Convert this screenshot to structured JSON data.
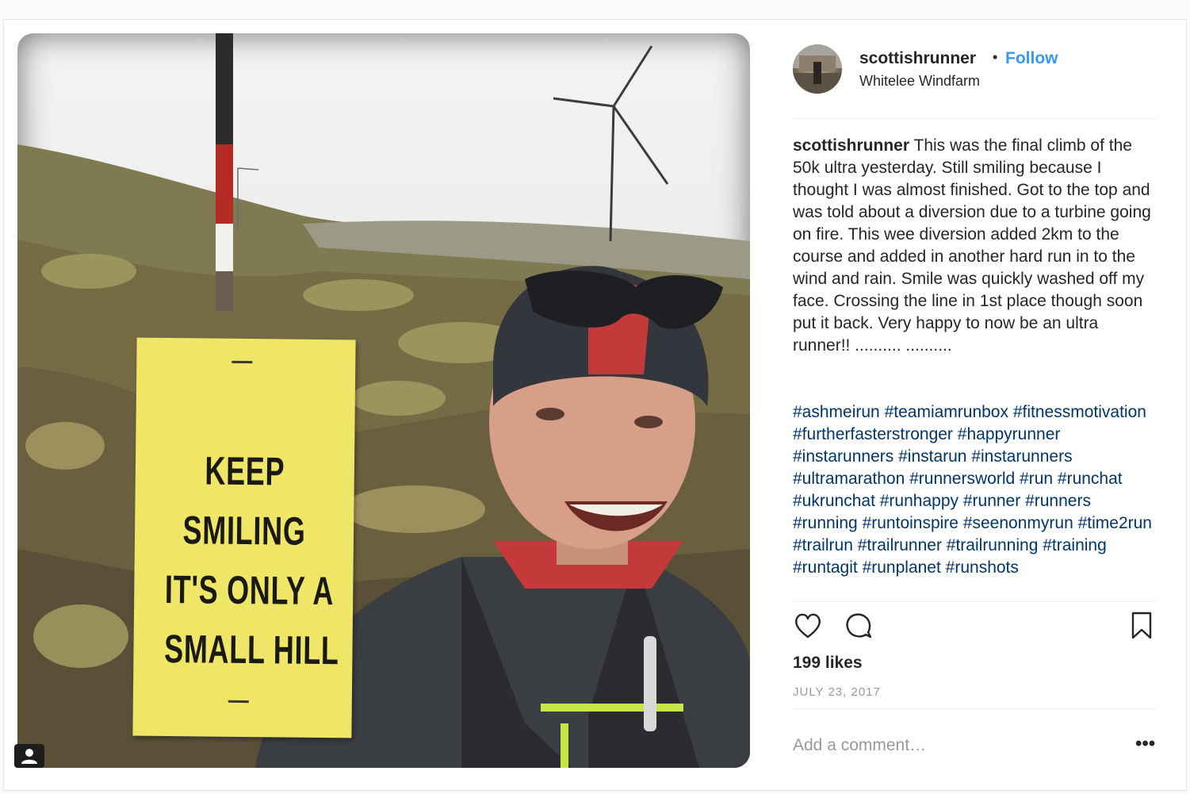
{
  "post": {
    "username": "scottishrunner",
    "separator": "•",
    "follow_label": "Follow",
    "location": "Whitelee Windfarm",
    "caption_user": "scottishrunner",
    "caption_text": "This was the final climb of the 50k ultra yesterday. Still smiling because I thought I was almost finished. Got to the top and was told about a diversion due to a turbine going on fire. This wee diversion added 2km to the course and added in another hard run in to the wind and rain. Smile was quickly washed off my face. Crossing the line in 1st place though soon put it back. Very happy to now be an ultra runner!! .......... ..........",
    "hashtags": [
      "#ashmeirun",
      "#teamiamrunbox",
      "#fitnessmotivation",
      "#furtherfasterstronger",
      "#happyrunner",
      "#instarunners",
      "#instarun",
      "#instarunners",
      "#ultramarathon",
      "#runnersworld",
      "#run",
      "#runchat",
      "#ukrunchat",
      "#runhappy",
      "#runner",
      "#runners",
      "#running",
      "#runtoinspire",
      "#seenonmyrun",
      "#time2run",
      "#trailrun",
      "#trailrunner",
      "#trailrunning",
      "#training",
      "#runtagit",
      "#runplanet",
      "#runshots"
    ],
    "likes": "199 likes",
    "date": "JULY 23, 2017",
    "comment_placeholder": "Add a comment…",
    "more_label": "•••"
  },
  "photo": {
    "sign_lines": [
      "KEEP",
      "SMILING",
      "IT'S ONLY A",
      "SMALL HILL"
    ]
  },
  "icons": {
    "like": "heart-icon",
    "comment": "comment-bubble-icon",
    "save": "bookmark-icon",
    "user_tag": "user-tag-icon"
  },
  "colors": {
    "link": "#3897f0",
    "hashtag": "#003569",
    "muted": "#999999",
    "text": "#262626"
  }
}
